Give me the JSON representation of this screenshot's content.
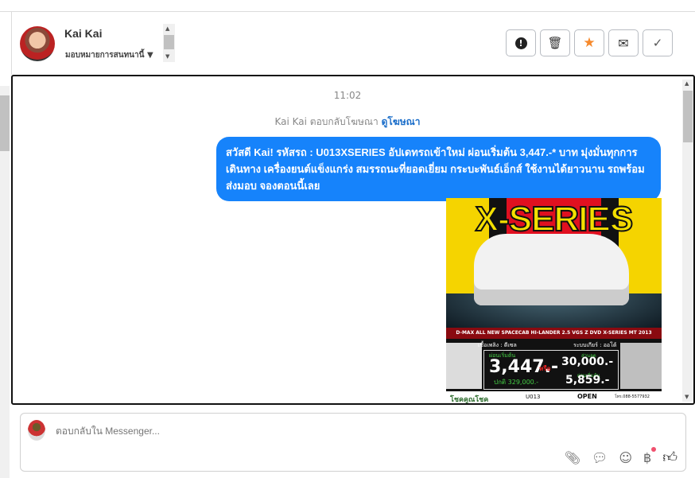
{
  "header": {
    "name": "Kai Kai",
    "assign_label": "มอบหมายการสนทนานี้"
  },
  "actions": [
    {
      "name": "mark-spam",
      "icon": "exclamation-icon"
    },
    {
      "name": "delete",
      "icon": "trash-icon"
    },
    {
      "name": "star",
      "icon": "star-icon"
    },
    {
      "name": "mark-unread",
      "icon": "envelope-icon"
    },
    {
      "name": "done",
      "icon": "check-icon"
    }
  ],
  "colors": {
    "accent": "#1683fb",
    "star": "#f6892c"
  },
  "chat": {
    "time": "11:02",
    "reply_prefix": "Kai Kai ตอบกลับโฆษณา",
    "reply_link": "ดูโฆษณา",
    "message": "สวัสดี Kai! รหัสรถ : U013XSERIES อัปเดทรถเข้าใหม่ ผ่อนเริ่มต้น 3,447.-* บาท มุ่งมั่นทุกการเดินทาง เครื่องยนต์แข็งแกร่ง สมรรถนะที่ยอดเยี่ยม กระบะพันธ์เอ็กส์ ใช้งานได้ยาวนาน รถพร้อมส่งมอบ จองตอนนี้เลย",
    "image": {
      "headline": "X-SERIES",
      "model": "D-MAX ALL NEW SPACECAB HI-LANDER 2.5 VGS Z DVD X-SERIES MT 2013",
      "fuel": "เชื้อเพลิง : ดีเซล",
      "gear": "ระบบเกียร์ : ออโต้",
      "installment_label": "ผ่อนเริ่มต้น",
      "installment": "3,447.-",
      "or": "หรือ",
      "normal_price": "ปกติ 329,000.-",
      "discount_label": "ส่วนลด",
      "discount": "30,000.-",
      "installment2_label": "ผ่อนเริ่มต้น",
      "installment2": "5,859.-",
      "shop": "โชคคูณโชค",
      "code": "U013",
      "open": "OPEN",
      "tel": "โทร.088-5577932"
    }
  },
  "composer": {
    "placeholder": "ตอบกลับใน Messenger..."
  }
}
